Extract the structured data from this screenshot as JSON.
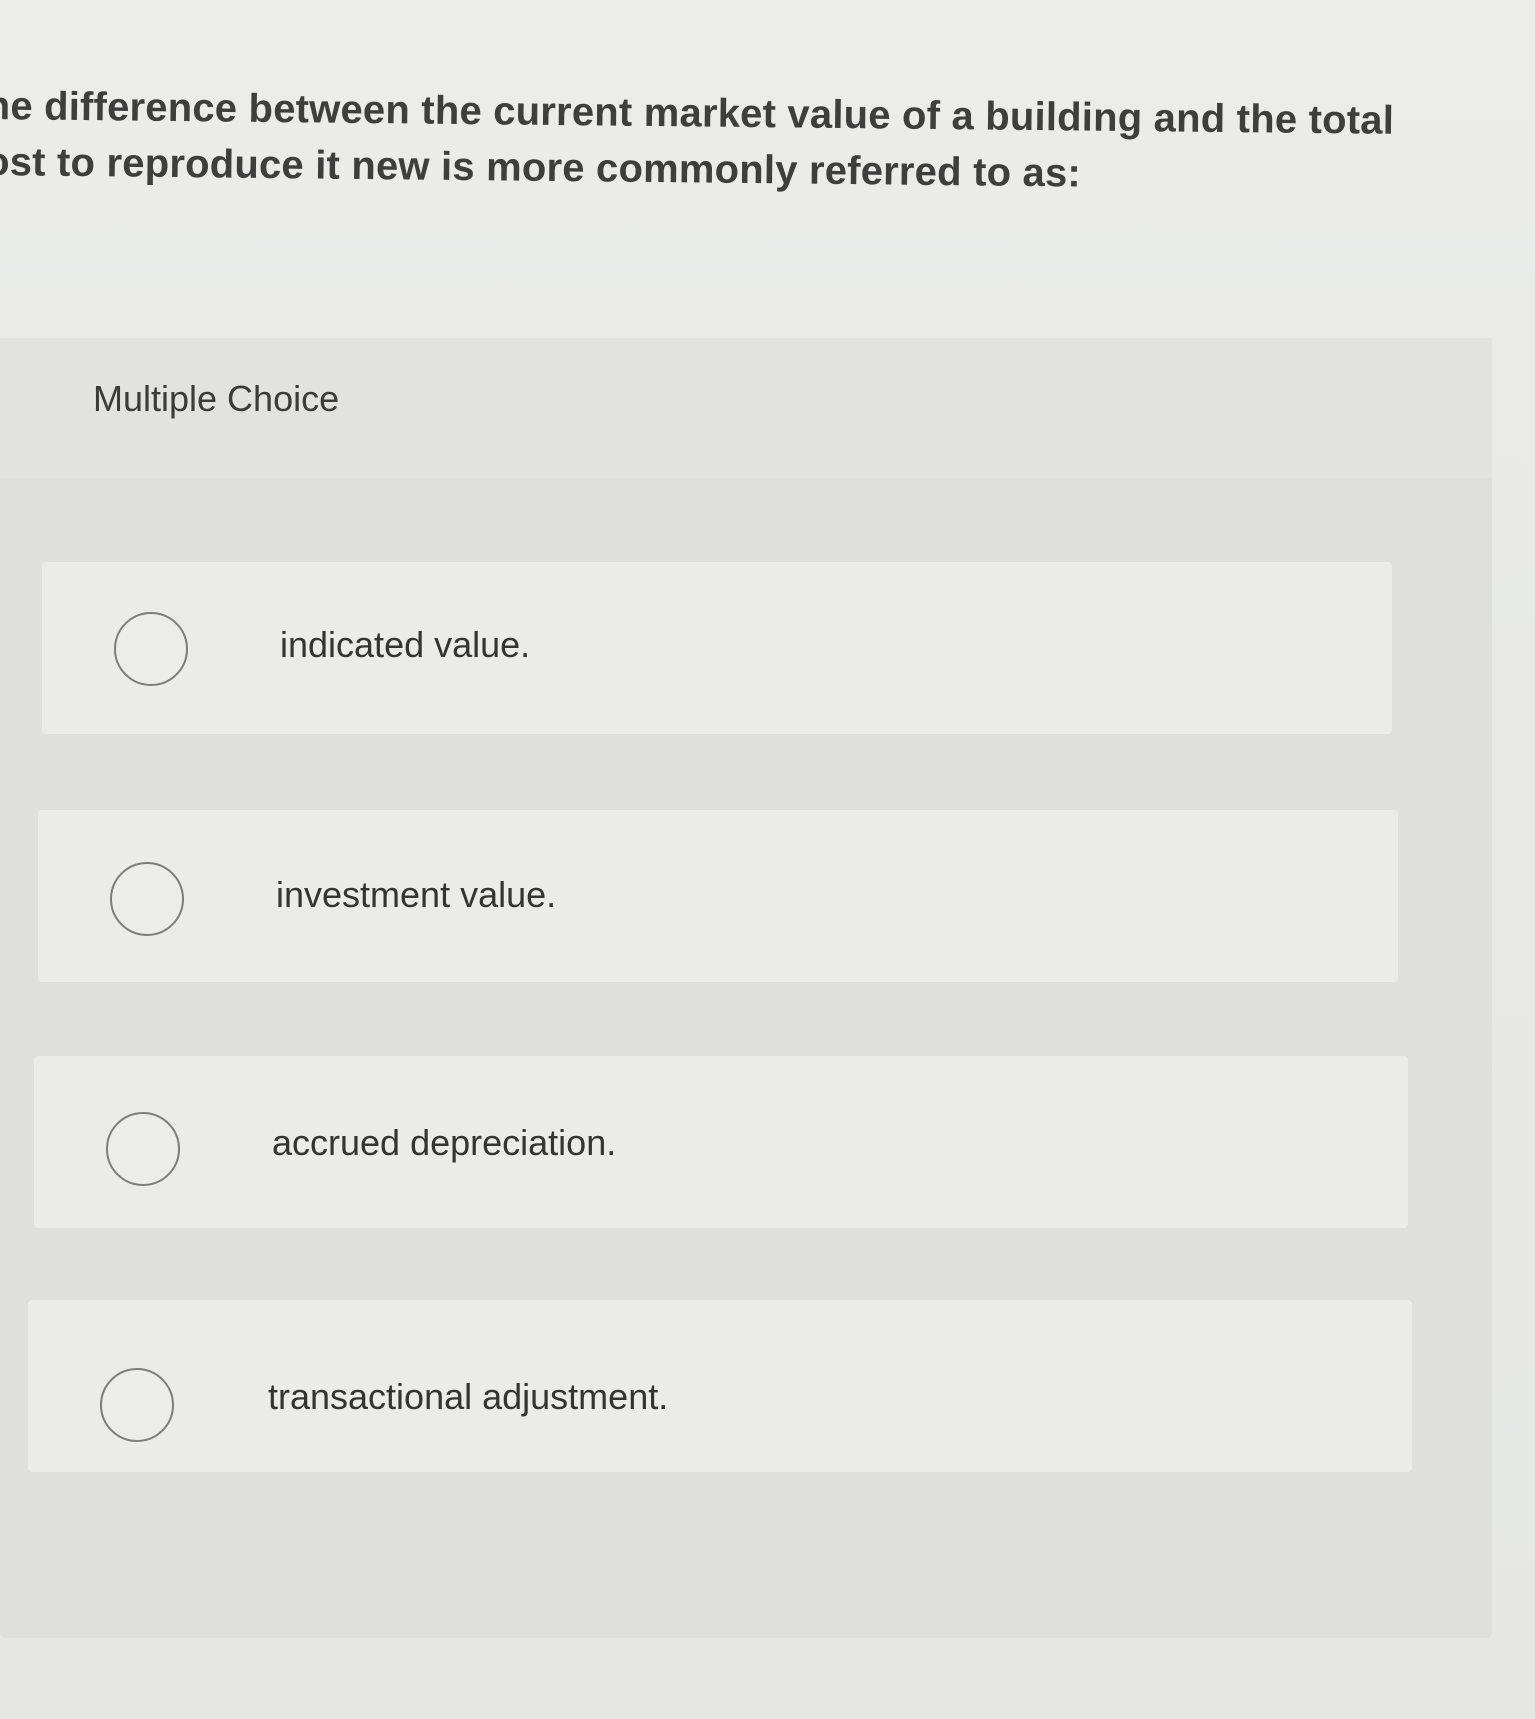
{
  "question": {
    "line1": "he difference between the current market value of a building and the total",
    "line2": "ost to reproduce it new is more commonly referred to as:"
  },
  "panel": {
    "type_label": "Multiple Choice"
  },
  "options": [
    {
      "label": "indicated value."
    },
    {
      "label": "investment value."
    },
    {
      "label": "accrued depreciation."
    },
    {
      "label": "transactional adjustment."
    }
  ]
}
